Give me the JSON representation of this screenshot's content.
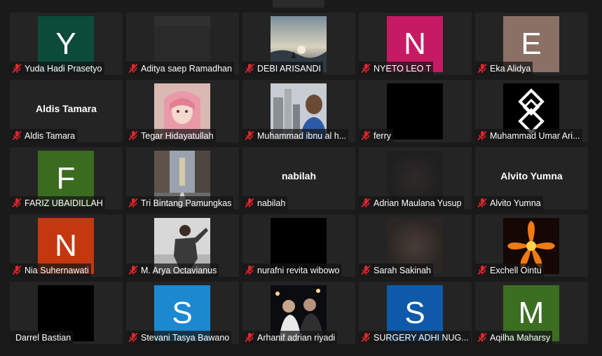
{
  "participants": [
    {
      "name": "Yuda Hadi Prasetyo",
      "kind": "initial",
      "initial": "Y",
      "color": "#0c4a3a",
      "muted": true
    },
    {
      "name": "Aditya saep Ramadhan",
      "kind": "photo",
      "photo": "blank-gray",
      "muted": true
    },
    {
      "name": "DEBI ARISANDI",
      "kind": "photo",
      "photo": "sunset-silhouette",
      "muted": true
    },
    {
      "name": "NYETO LEO T",
      "kind": "initial",
      "initial": "N",
      "color": "#c61a64",
      "muted": true
    },
    {
      "name": "Eka Alidya",
      "kind": "initial",
      "initial": "E",
      "color": "#8b7065",
      "muted": true
    },
    {
      "name": "Aldis Tamara",
      "kind": "text",
      "display": "Aldis Tamara",
      "muted": true
    },
    {
      "name": "Tegar Hidayatullah",
      "kind": "photo",
      "photo": "anime-pink-hair",
      "muted": true
    },
    {
      "name": "Muhammad ibnu al h...",
      "kind": "photo",
      "photo": "city-selfie",
      "muted": true
    },
    {
      "name": "ferry",
      "kind": "photo",
      "photo": "black",
      "muted": true
    },
    {
      "name": "Muhammad Umar Ari...",
      "kind": "photo",
      "photo": "geometric-logo",
      "muted": true
    },
    {
      "name": "FARIZ UBAIDILLAH",
      "kind": "initial",
      "initial": "F",
      "color": "#3a6b1e",
      "muted": true
    },
    {
      "name": "Tri Bintang Pamungkas",
      "kind": "photo",
      "photo": "city-street",
      "muted": true
    },
    {
      "name": "nabilah",
      "kind": "text",
      "display": "nabilah",
      "muted": true
    },
    {
      "name": "Adrian Maulana Yusup",
      "kind": "photo",
      "photo": "dark-blur",
      "muted": true
    },
    {
      "name": "Alvito Yumna",
      "kind": "text",
      "display": "Alvito Yumna",
      "muted": true
    },
    {
      "name": "Nia Suhernawati",
      "kind": "initial",
      "initial": "N",
      "color": "#c4380f",
      "muted": true
    },
    {
      "name": "M. Arya Octavianus",
      "kind": "photo",
      "photo": "person-posing",
      "muted": true
    },
    {
      "name": "nurafni revita wibowo",
      "kind": "photo",
      "photo": "black",
      "muted": true
    },
    {
      "name": "Sarah Sakinah",
      "kind": "photo",
      "photo": "blurred-face",
      "muted": true
    },
    {
      "name": "Exchell Ointu",
      "kind": "photo",
      "photo": "fire-flower",
      "muted": true
    },
    {
      "name": "Darrel Bastian",
      "kind": "photo",
      "photo": "black",
      "muted": false
    },
    {
      "name": "Stevani Tasya Bawano",
      "kind": "initial",
      "initial": "S",
      "color": "#1b88d0",
      "muted": true
    },
    {
      "name": "Arhanif adrian riyadi",
      "kind": "photo",
      "photo": "night-group",
      "muted": true
    },
    {
      "name": "SURGERY ADHI NUG...",
      "kind": "initial",
      "initial": "S",
      "color": "#0e5aa8",
      "muted": true
    },
    {
      "name": "Aqilha Maharsy",
      "kind": "initial",
      "initial": "M",
      "color": "#3c6e22",
      "muted": true
    }
  ],
  "colors": {
    "background": "#1a1a1a",
    "tile": "#242424",
    "mute_icon": "#e0262c"
  }
}
